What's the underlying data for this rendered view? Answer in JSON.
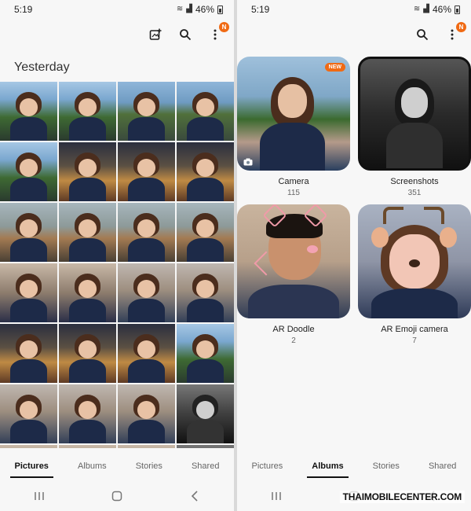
{
  "left": {
    "status": {
      "time": "5:19",
      "battery": "46%"
    },
    "icons": {
      "select": "add-photo-icon",
      "search": "search-icon",
      "more": "more-vertical-icon",
      "badge": "N"
    },
    "section_title": "Yesterday",
    "tabs": [
      "Pictures",
      "Albums",
      "Stories",
      "Shared"
    ],
    "active_tab": "Pictures"
  },
  "right": {
    "status": {
      "time": "5:19",
      "battery": "46%"
    },
    "icons": {
      "search": "search-icon",
      "more": "more-vertical-icon",
      "badge": "N"
    },
    "albums": [
      {
        "name": "Camera",
        "count": "115",
        "badge": "NEW"
      },
      {
        "name": "Screenshots",
        "count": "351"
      },
      {
        "name": "AR Doodle",
        "count": "2"
      },
      {
        "name": "AR Emoji camera",
        "count": "7"
      }
    ],
    "tabs": [
      "Pictures",
      "Albums",
      "Stories",
      "Shared"
    ],
    "active_tab": "Albums"
  },
  "watermark": "THAIMOBILECENTER.COM"
}
